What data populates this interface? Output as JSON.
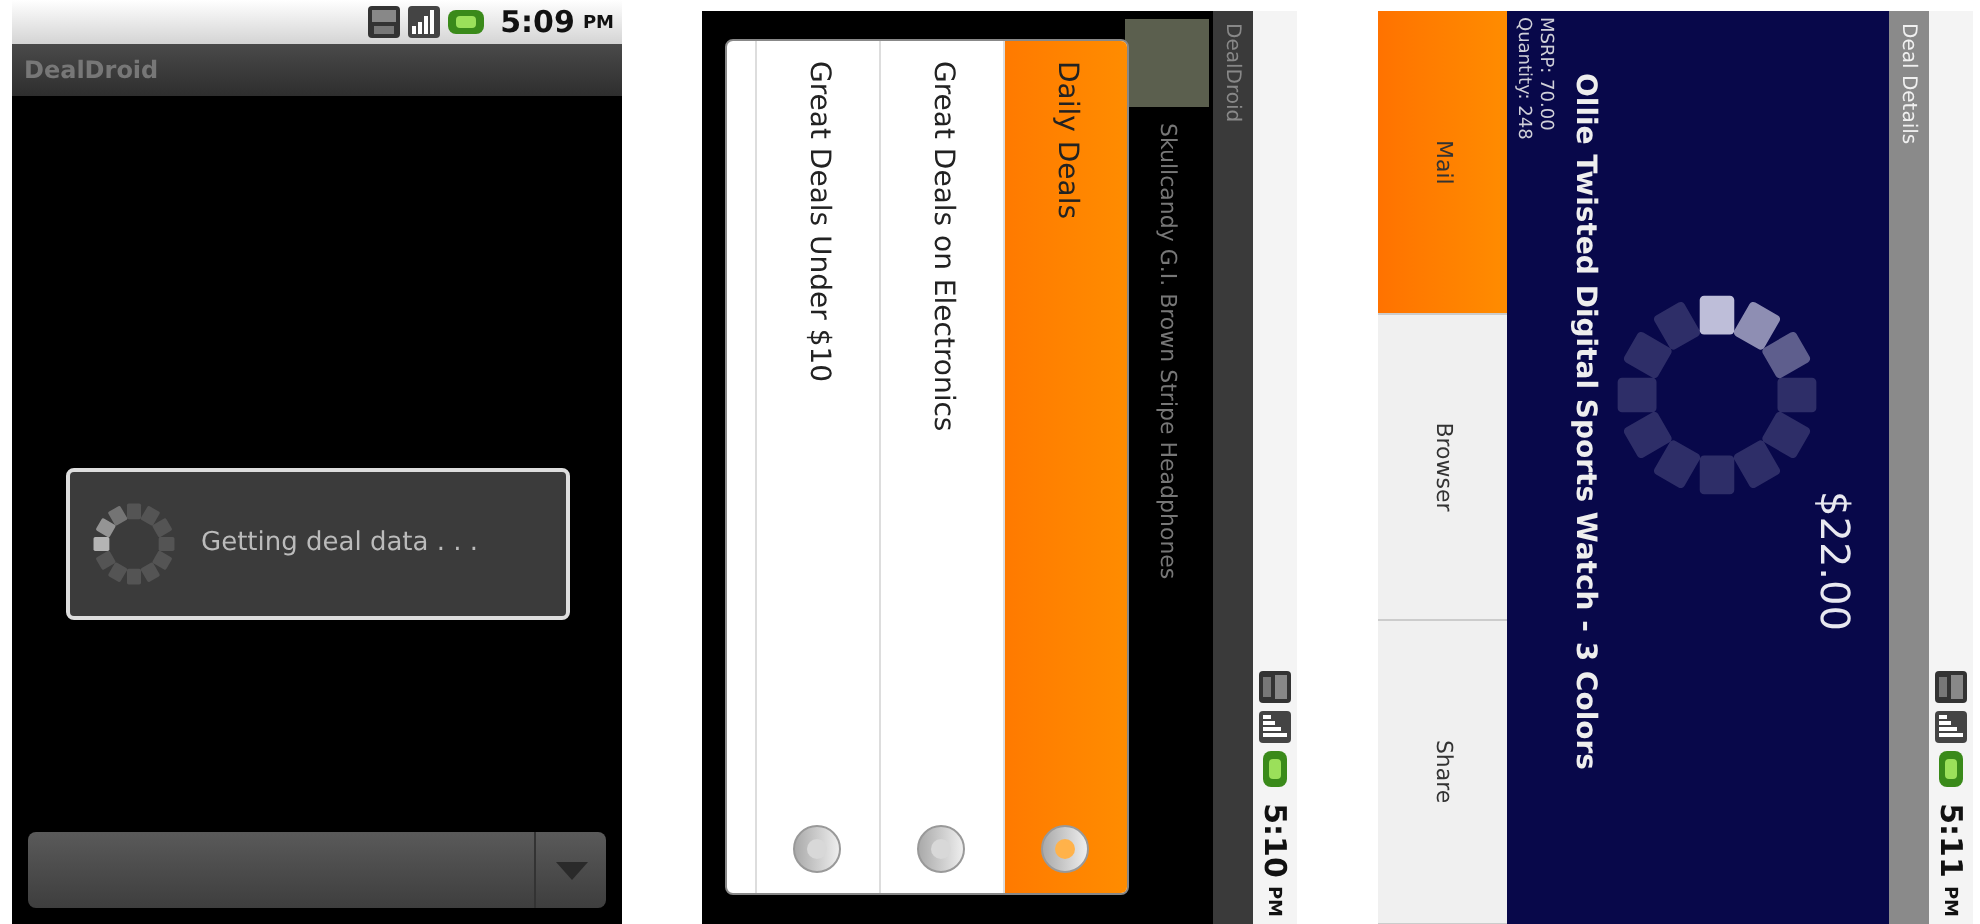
{
  "loading_screen": {
    "status_time": "5:09",
    "status_ampm": "PM",
    "title": "DealDroid",
    "dialog": {
      "message": "Getting deal data . . ."
    }
  },
  "category_screen": {
    "status_time": "5:10",
    "status_ampm": "PM",
    "title": "DealDroid",
    "list_item": {
      "name": "Skullcandy G.I. Brown Stripe Headphones"
    },
    "dialog": {
      "options": [
        {
          "label": "Daily Deals",
          "selected": true
        },
        {
          "label": "Great Deals on Electronics",
          "selected": false
        },
        {
          "label": "Great Deals Under $10",
          "selected": false
        }
      ]
    }
  },
  "details_screen": {
    "status_time": "5:11",
    "status_ampm": "PM",
    "title": "Deal Details",
    "price": "$22.00",
    "product_name": "Ollie Twisted Digital Sports Watch - 3 Colors",
    "msrp": "MSRP: 70.00",
    "quantity": "Quantity: 248",
    "actions": [
      {
        "label": "Mail",
        "selected": true
      },
      {
        "label": "Browser",
        "selected": false
      },
      {
        "label": "Share",
        "selected": false
      }
    ]
  }
}
